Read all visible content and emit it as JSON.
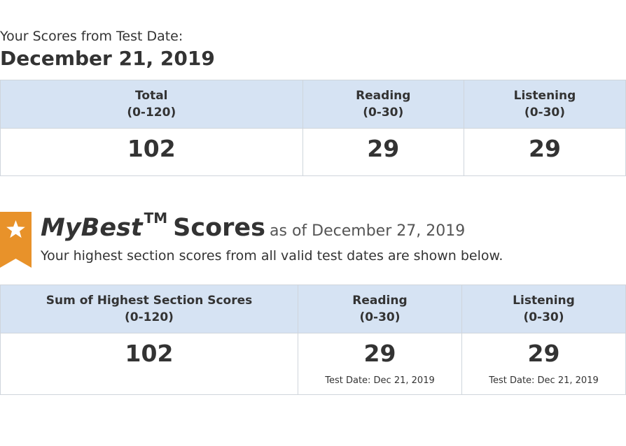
{
  "header": {
    "subhead": "Your Scores from Test Date:",
    "test_date": "December 21, 2019"
  },
  "scores_table": {
    "columns": [
      {
        "label": "Total",
        "range": "(0-120)",
        "value": "102"
      },
      {
        "label": "Reading",
        "range": "(0-30)",
        "value": "29"
      },
      {
        "label": "Listening",
        "range": "(0-30)",
        "value": "29"
      }
    ]
  },
  "mybest": {
    "title_brand": "MyBest",
    "trademark": "TM",
    "title_word": "Scores",
    "as_of": "as of December 27, 2019",
    "description": "Your highest section scores from all valid test dates are shown below.",
    "badge_icon": "star-ribbon-icon",
    "badge_color": "#e8922a",
    "columns": [
      {
        "label": "Sum of Highest Section Scores",
        "range": "(0-120)",
        "value": "102",
        "test_date": ""
      },
      {
        "label": "Reading",
        "range": "(0-30)",
        "value": "29",
        "test_date": "Test Date: Dec 21, 2019"
      },
      {
        "label": "Listening",
        "range": "(0-30)",
        "value": "29",
        "test_date": "Test Date: Dec 21, 2019"
      }
    ]
  },
  "colors": {
    "header_bg": "#d6e3f3",
    "border": "#cfd5dc",
    "text": "#333333"
  }
}
